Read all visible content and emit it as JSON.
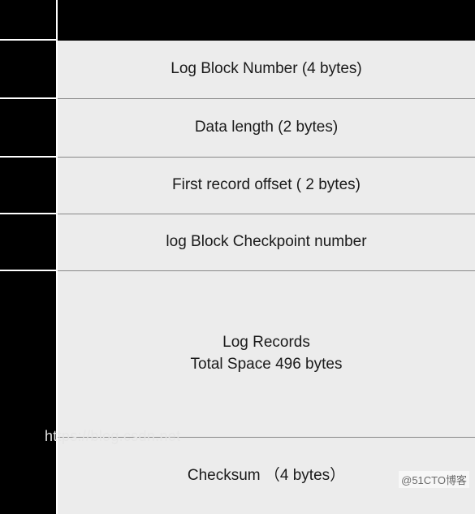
{
  "diagram": {
    "rows": [
      {
        "label": ""
      },
      {
        "label": "Log Block Number (4 bytes)"
      },
      {
        "label": "Data length (2 bytes)"
      },
      {
        "label": "First record offset ( 2 bytes)"
      },
      {
        "label": "log Block Checkpoint number"
      },
      {
        "line1": "Log Records",
        "line2": "Total Space 496 bytes"
      },
      {
        "label": "Checksum （4 bytes）"
      }
    ]
  },
  "watermarks": {
    "faint": "https://blog.csdn.net",
    "corner": "@51CTO博客"
  }
}
